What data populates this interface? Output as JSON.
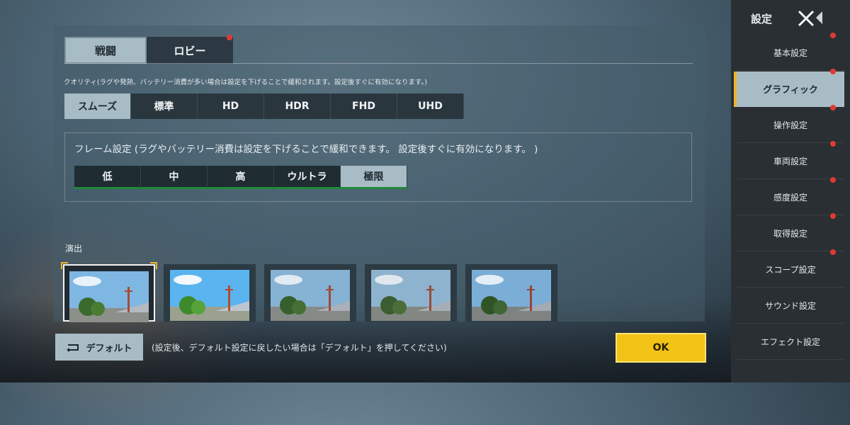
{
  "tabs": [
    {
      "label": "戦闘",
      "active": true,
      "badge": false
    },
    {
      "label": "ロビー",
      "active": false,
      "badge": true
    }
  ],
  "quality": {
    "label": "クオリティ(ラグや発熱、バッテリー消費が多い場合は設定を下げることで緩和されます。設定後すぐに有効になります。)",
    "options": [
      "スムーズ",
      "標準",
      "HD",
      "HDR",
      "FHD",
      "UHD"
    ],
    "selected": "スムーズ"
  },
  "frame": {
    "label": "フレーム設定 (ラグやバッテリー消費は設定を下げることで緩和できます。 設定後すぐに有効になります。 )",
    "options": [
      "低",
      "中",
      "高",
      "ウルトラ",
      "極限"
    ],
    "selected": "極限"
  },
  "effects": {
    "label": "演出",
    "thumbnails": [
      {
        "selected": true
      },
      {
        "selected": false
      },
      {
        "selected": false
      },
      {
        "selected": false
      },
      {
        "selected": false
      }
    ]
  },
  "footer": {
    "default_label": "デフォルト",
    "hint": "(設定後、デフォルト設定に戻したい場合は「デフォルト」を押してください)",
    "ok_label": "OK"
  },
  "sidebar": {
    "title": "設定",
    "items": [
      {
        "label": "基本設定",
        "badge": true,
        "active": false
      },
      {
        "label": "グラフィック",
        "badge": true,
        "active": true
      },
      {
        "label": "操作設定",
        "badge": true,
        "active": false
      },
      {
        "label": "車両設定",
        "badge": true,
        "active": false
      },
      {
        "label": "感度設定",
        "badge": true,
        "active": false
      },
      {
        "label": "取得設定",
        "badge": true,
        "active": false
      },
      {
        "label": "スコープ設定",
        "badge": true,
        "active": false
      },
      {
        "label": "サウンド設定",
        "badge": false,
        "active": false
      },
      {
        "label": "エフェクト設定",
        "badge": false,
        "active": false
      }
    ]
  },
  "colors": {
    "accent_active": "#a8bcc6",
    "ok_yellow": "#f2c416",
    "badge_red": "#e03a36",
    "frame_underline_green": "#1f8a3c",
    "selection_corner": "#f5b82a"
  }
}
